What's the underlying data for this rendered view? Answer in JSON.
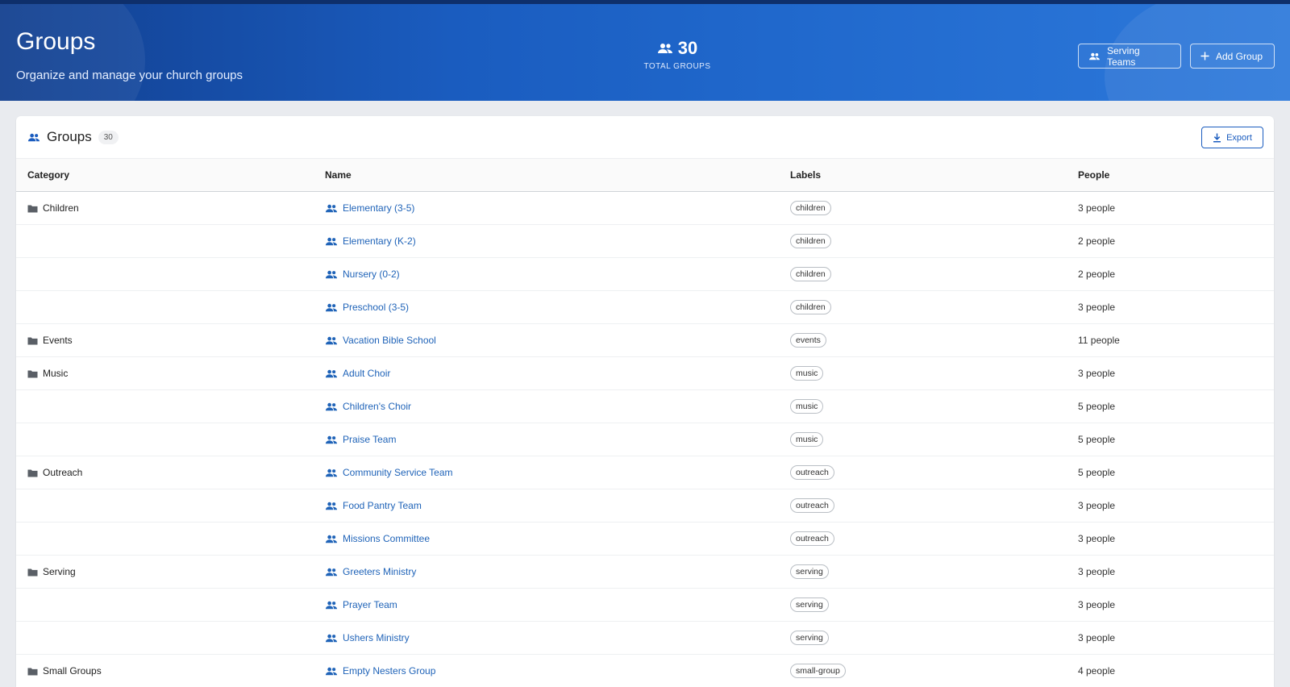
{
  "header": {
    "title": "Groups",
    "subtitle": "Organize and manage your church groups",
    "total_value": "30",
    "total_label": "TOTAL GROUPS",
    "serving_teams_label": "Serving Teams",
    "add_group_label": "Add Group"
  },
  "card": {
    "title": "Groups",
    "count": "30",
    "export_label": "Export"
  },
  "columns": {
    "category": "Category",
    "name": "Name",
    "labels": "Labels",
    "people": "People"
  },
  "rows": [
    {
      "category": "Children",
      "name": "Elementary (3-5)",
      "label": "children",
      "people": "3 people"
    },
    {
      "category": "",
      "name": "Elementary (K-2)",
      "label": "children",
      "people": "2 people"
    },
    {
      "category": "",
      "name": "Nursery (0-2)",
      "label": "children",
      "people": "2 people"
    },
    {
      "category": "",
      "name": "Preschool (3-5)",
      "label": "children",
      "people": "3 people"
    },
    {
      "category": "Events",
      "name": "Vacation Bible School",
      "label": "events",
      "people": "11 people"
    },
    {
      "category": "Music",
      "name": "Adult Choir",
      "label": "music",
      "people": "3 people"
    },
    {
      "category": "",
      "name": "Children's Choir",
      "label": "music",
      "people": "5 people"
    },
    {
      "category": "",
      "name": "Praise Team",
      "label": "music",
      "people": "5 people"
    },
    {
      "category": "Outreach",
      "name": "Community Service Team",
      "label": "outreach",
      "people": "5 people"
    },
    {
      "category": "",
      "name": "Food Pantry Team",
      "label": "outreach",
      "people": "3 people"
    },
    {
      "category": "",
      "name": "Missions Committee",
      "label": "outreach",
      "people": "3 people"
    },
    {
      "category": "Serving",
      "name": "Greeters Ministry",
      "label": "serving",
      "people": "3 people"
    },
    {
      "category": "",
      "name": "Prayer Team",
      "label": "serving",
      "people": "3 people"
    },
    {
      "category": "",
      "name": "Ushers Ministry",
      "label": "serving",
      "people": "3 people"
    },
    {
      "category": "Small Groups",
      "name": "Empty Nesters Group",
      "label": "small-group",
      "people": "4 people"
    }
  ],
  "icons": {
    "group": "group-icon",
    "folder": "folder-icon",
    "plus": "plus-icon",
    "download": "download-icon"
  },
  "colors": {
    "brand_blue": "#1a5cbf",
    "link_blue": "#1f63b8"
  }
}
